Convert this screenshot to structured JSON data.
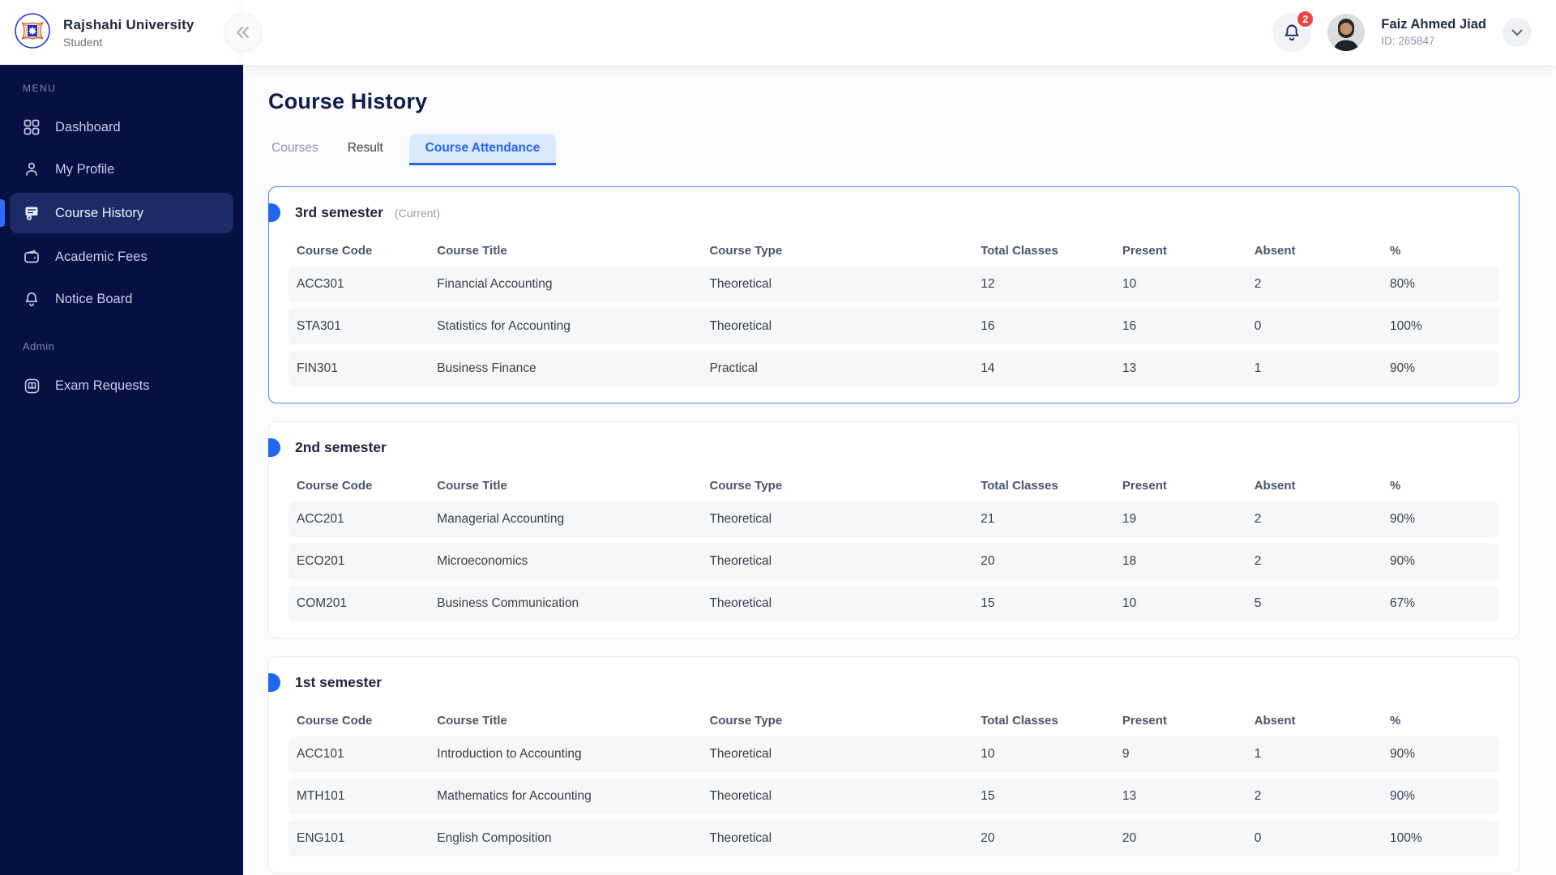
{
  "sidebar": {
    "brand": {
      "title": "Rajshahi University",
      "subtitle": "Student"
    },
    "menu_label": "MENU",
    "admin_label": "Admin",
    "items": [
      {
        "label": "Dashboard",
        "icon": "grid-icon",
        "active": false
      },
      {
        "label": "My Profile",
        "icon": "user-icon",
        "active": false
      },
      {
        "label": "Course History",
        "icon": "history-icon",
        "active": true
      },
      {
        "label": "Academic Fees",
        "icon": "wallet-icon",
        "active": false
      },
      {
        "label": "Notice Board",
        "icon": "bell-icon",
        "active": false
      }
    ],
    "admin_items": [
      {
        "label": "Exam Requests",
        "icon": "book-icon",
        "active": false
      }
    ]
  },
  "header": {
    "notification_count": "2",
    "user_name": "Faiz Ahmed Jiad",
    "user_id": "ID: 265847"
  },
  "page": {
    "title": "Course History",
    "tabs": [
      {
        "label": "Courses",
        "active": false
      },
      {
        "label": "Result",
        "active": false
      },
      {
        "label": "Course Attendance",
        "active": true
      }
    ]
  },
  "table_headers": [
    "Course Code",
    "Course Title",
    "Course Type",
    "Total Classes",
    "Present",
    "Absent",
    "%"
  ],
  "semesters": [
    {
      "title": "3rd semester",
      "badge": "(Current)",
      "current": true,
      "rows": [
        [
          "ACC301",
          "Financial Accounting",
          "Theoretical",
          "12",
          "10",
          "2",
          "80%"
        ],
        [
          "STA301",
          "Statistics for Accounting",
          "Theoretical",
          "16",
          "16",
          "0",
          "100%"
        ],
        [
          "FIN301",
          "Business Finance",
          "Practical",
          "14",
          "13",
          "1",
          "90%"
        ]
      ]
    },
    {
      "title": "2nd semester",
      "current": false,
      "rows": [
        [
          "ACC201",
          "Managerial Accounting",
          "Theoretical",
          "21",
          "19",
          "2",
          "90%"
        ],
        [
          "ECO201",
          "Microeconomics",
          "Theoretical",
          "20",
          "18",
          "2",
          "90%"
        ],
        [
          "COM201",
          "Business Communication",
          "Theoretical",
          "15",
          "10",
          "5",
          "67%"
        ]
      ]
    },
    {
      "title": "1st semester",
      "current": false,
      "rows": [
        [
          "ACC101",
          "Introduction to Accounting",
          "Theoretical",
          "10",
          "9",
          "1",
          "90%"
        ],
        [
          "MTH101",
          "Mathematics for Accounting",
          "Theoretical",
          "15",
          "13",
          "2",
          "90%"
        ],
        [
          "ENG101",
          "English Composition",
          "Theoretical",
          "20",
          "20",
          "0",
          "100%"
        ]
      ]
    }
  ],
  "colors": {
    "sidebar_bg": "#071043",
    "active_item_bg": "#1c2b66",
    "accent_blue": "#2563eb",
    "current_card_border": "#4f86f7",
    "badge_red": "#ef4444",
    "tab_active_bg": "#dbeafb",
    "row_bg": "#f6f7f9",
    "title_navy": "#111c4e"
  }
}
